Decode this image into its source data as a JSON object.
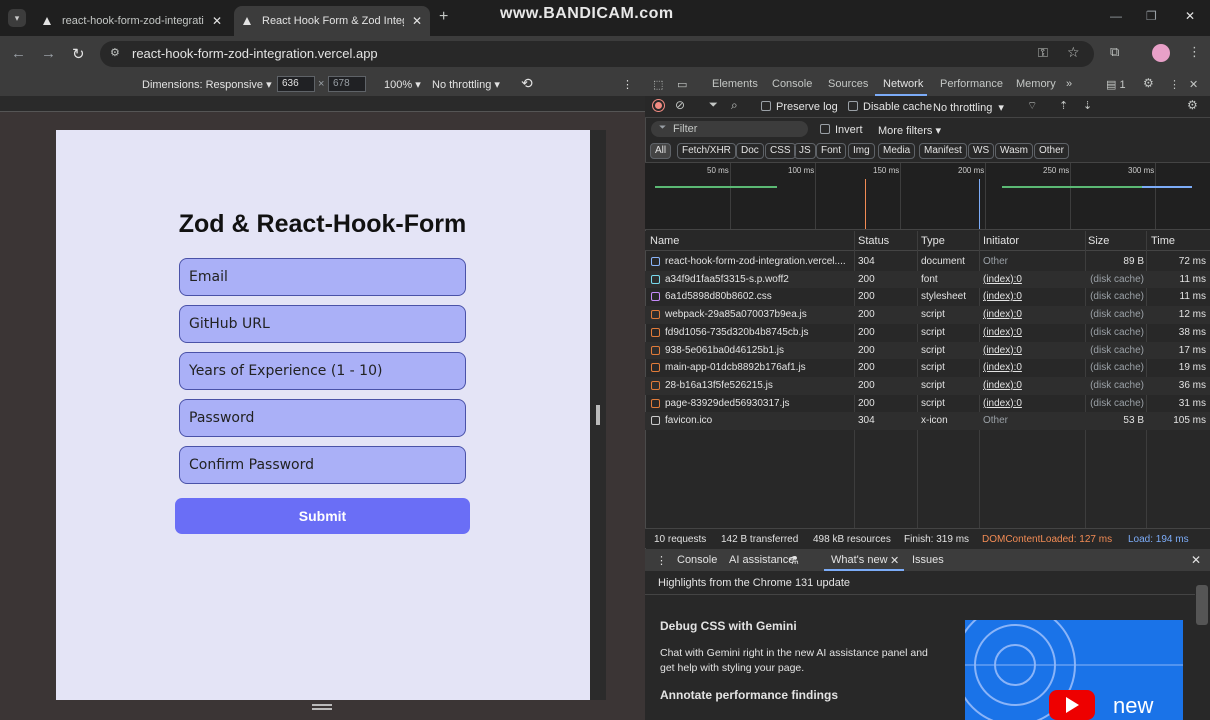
{
  "browser": {
    "tabs": [
      {
        "title": "react-hook-form-zod-integratio",
        "active": false
      },
      {
        "title": "React Hook Form & Zod Integr",
        "active": true
      }
    ],
    "new_tab": "+",
    "watermark": "www.BANDICAM.com",
    "url": "react-hook-form-zod-integration.vercel.app"
  },
  "device_toolbar": {
    "dimensions": "Dimensions: Responsive",
    "width": "636",
    "height": "678",
    "times": "×",
    "zoom": "100%",
    "throttling": "No throttling"
  },
  "form": {
    "title": "Zod & React-Hook-Form",
    "fields": [
      {
        "placeholder": "Email"
      },
      {
        "placeholder": "GitHub URL"
      },
      {
        "placeholder": "Years of Experience (1 - 10)"
      },
      {
        "placeholder": "Password"
      },
      {
        "placeholder": "Confirm Password"
      }
    ],
    "submit": "Submit"
  },
  "devtools": {
    "tabs": [
      "Elements",
      "Console",
      "Sources",
      "Network",
      "Performance",
      "Memory"
    ],
    "active_tab": "Network",
    "more": "»",
    "issues_count": "1",
    "network_toolbar": {
      "preserve_log": "Preserve log",
      "disable_cache": "Disable cache",
      "throttling": "No throttling"
    },
    "filter": {
      "placeholder": "Filter",
      "invert": "Invert",
      "more_filters": "More filters"
    },
    "type_chips": [
      "All",
      "Fetch/XHR",
      "Doc",
      "CSS",
      "JS",
      "Font",
      "Img",
      "Media",
      "Manifest",
      "WS",
      "Wasm",
      "Other"
    ],
    "overview_ticks": [
      "50 ms",
      "100 ms",
      "150 ms",
      "200 ms",
      "250 ms",
      "300 ms"
    ],
    "columns": [
      "Name",
      "Status",
      "Type",
      "Initiator",
      "Size",
      "Time"
    ],
    "requests": [
      {
        "name": "react-hook-form-zod-integration.vercel....",
        "status": "304",
        "type": "document",
        "initiator": "Other",
        "size": "89 B",
        "time": "72 ms"
      },
      {
        "name": "a34f9d1faa5f3315-s.p.woff2",
        "status": "200",
        "type": "font",
        "initiator": "(index):0",
        "size": "(disk cache)",
        "time": "11 ms"
      },
      {
        "name": "6a1d5898d80b8602.css",
        "status": "200",
        "type": "stylesheet",
        "initiator": "(index):0",
        "size": "(disk cache)",
        "time": "11 ms"
      },
      {
        "name": "webpack-29a85a070037b9ea.js",
        "status": "200",
        "type": "script",
        "initiator": "(index):0",
        "size": "(disk cache)",
        "time": "12 ms"
      },
      {
        "name": "fd9d1056-735d320b4b8745cb.js",
        "status": "200",
        "type": "script",
        "initiator": "(index):0",
        "size": "(disk cache)",
        "time": "38 ms"
      },
      {
        "name": "938-5e061ba0d46125b1.js",
        "status": "200",
        "type": "script",
        "initiator": "(index):0",
        "size": "(disk cache)",
        "time": "17 ms"
      },
      {
        "name": "main-app-01dcb8892b176af1.js",
        "status": "200",
        "type": "script",
        "initiator": "(index):0",
        "size": "(disk cache)",
        "time": "19 ms"
      },
      {
        "name": "28-b16a13f5fe526215.js",
        "status": "200",
        "type": "script",
        "initiator": "(index):0",
        "size": "(disk cache)",
        "time": "36 ms"
      },
      {
        "name": "page-83929ded56930317.js",
        "status": "200",
        "type": "script",
        "initiator": "(index):0",
        "size": "(disk cache)",
        "time": "31 ms"
      },
      {
        "name": "favicon.ico",
        "status": "304",
        "type": "x-icon",
        "initiator": "Other",
        "size": "53 B",
        "time": "105 ms"
      }
    ],
    "summary": {
      "requests": "10 requests",
      "transferred": "142 B transferred",
      "resources": "498 kB resources",
      "finish": "Finish: 319 ms",
      "dcl": "DOMContentLoaded: 127 ms",
      "load": "Load: 194 ms"
    },
    "drawer": {
      "tabs": [
        "Console",
        "AI assistance",
        "What's new",
        "Issues"
      ],
      "highlights": "Highlights from the Chrome 131 update",
      "debug_title": "Debug CSS with Gemini",
      "debug_text": "Chat with Gemini right in the new AI assistance panel and get help with styling your page.",
      "annotate_title": "Annotate performance findings",
      "promo_text": "new"
    },
    "colors": {
      "accent": "#7cacf8",
      "dcl": "#f28b54",
      "load": "#7cacf8",
      "submit": "#6a6ef6",
      "field": "#aab0f7"
    }
  }
}
